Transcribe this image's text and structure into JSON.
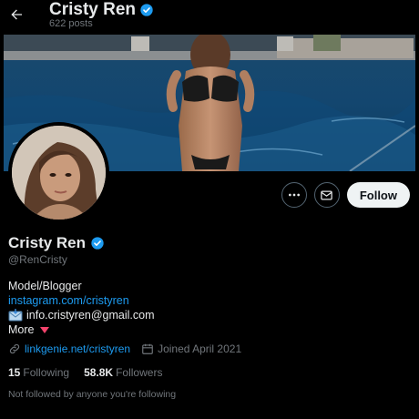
{
  "header": {
    "name": "Cristy Ren",
    "posts_count": "622 posts"
  },
  "profile": {
    "name": "Cristy Ren",
    "handle": "@RenCristy",
    "bio": {
      "line1": "Model/Blogger",
      "instagram": "instagram.com/cristyren",
      "email": "info.cristyren@gmail.com",
      "more": "More"
    },
    "website": "linkgenie.net/cristyren",
    "joined": "Joined April 2021",
    "following_count": "15",
    "following_label": "Following",
    "followers_count": "58.8K",
    "followers_label": "Followers",
    "not_followed": "Not followed by anyone you're following"
  },
  "actions": {
    "follow_label": "Follow"
  },
  "colors": {
    "accent": "#1d9bf0",
    "background": "#000000",
    "text": "#e7e9ea",
    "muted": "#71767b"
  },
  "icons": [
    "back-arrow-icon",
    "verified-badge-icon",
    "more-icon",
    "message-icon",
    "link-icon",
    "calendar-icon",
    "envelope-emoji-icon",
    "triangle-down-icon"
  ]
}
